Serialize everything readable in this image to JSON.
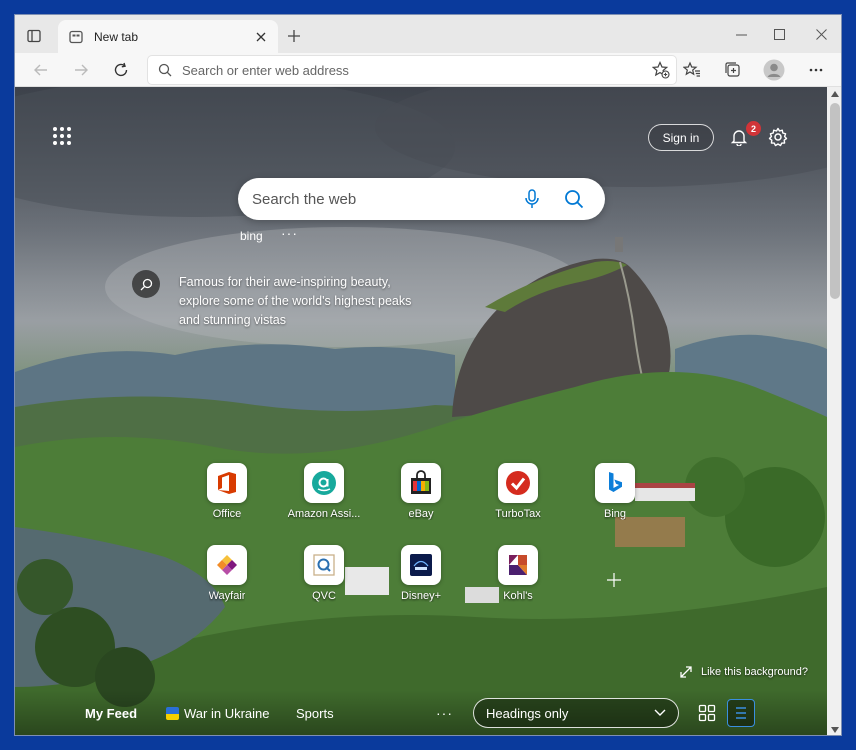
{
  "tab": {
    "title": "New tab"
  },
  "address_bar": {
    "placeholder": "Search or enter web address"
  },
  "header": {
    "signin_label": "Sign in",
    "notification_count": "2"
  },
  "search": {
    "placeholder": "Search the web",
    "provider": "bing",
    "more": "···"
  },
  "fact": {
    "text": "Famous for their awe-inspiring beauty, explore some of the world's highest peaks and stunning vistas"
  },
  "quick_links": [
    {
      "label": "Office"
    },
    {
      "label": "Amazon Assi..."
    },
    {
      "label": "eBay"
    },
    {
      "label": "TurboTax"
    },
    {
      "label": "Bing"
    },
    {
      "label": "Wayfair"
    },
    {
      "label": "QVC"
    },
    {
      "label": "Disney+"
    },
    {
      "label": "Kohl's"
    }
  ],
  "background": {
    "like_label": "Like this background?"
  },
  "feed": {
    "my_feed": "My Feed",
    "war_in_ukraine": "War in Ukraine",
    "sports": "Sports",
    "more": "···",
    "headings_label": "Headings only"
  },
  "colors": {
    "accent": "#0078d4",
    "badge": "#d13438",
    "desktop": "#0a3a9c"
  }
}
